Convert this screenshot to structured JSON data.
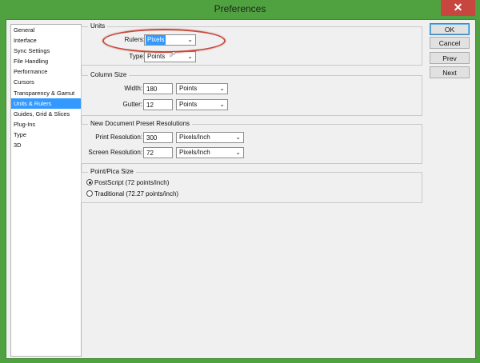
{
  "window": {
    "title": "Preferences",
    "close_glyph": "✕"
  },
  "sidebar": {
    "items": [
      {
        "label": "General"
      },
      {
        "label": "Interface"
      },
      {
        "label": "Sync Settings"
      },
      {
        "label": "File Handling"
      },
      {
        "label": "Performance"
      },
      {
        "label": "Cursors"
      },
      {
        "label": "Transparency & Gamut"
      },
      {
        "label": "Units & Rulers"
      },
      {
        "label": "Guides, Grid & Slices"
      },
      {
        "label": "Plug-Ins"
      },
      {
        "label": "Type"
      },
      {
        "label": "3D"
      }
    ],
    "selected": "Units & Rulers"
  },
  "units": {
    "legend": "Units",
    "rulers_label": "Rulers:",
    "rulers_value": "Pixels",
    "type_label": "Type:",
    "type_value": "Points"
  },
  "column_size": {
    "legend": "Column Size",
    "width_label": "Width:",
    "width_value": "180",
    "width_unit": "Points",
    "gutter_label": "Gutter:",
    "gutter_value": "12",
    "gutter_unit": "Points"
  },
  "preset_resolutions": {
    "legend": "New Document Preset Resolutions",
    "print_label": "Print Resolution:",
    "print_value": "300",
    "print_unit": "Pixels/Inch",
    "screen_label": "Screen Resolution:",
    "screen_value": "72",
    "screen_unit": "Pixels/Inch"
  },
  "point_pica": {
    "legend": "Point/Pica Size",
    "options": [
      {
        "label": "PostScript (72 points/inch)",
        "selected": true
      },
      {
        "label": "Traditional (72.27 points/inch)",
        "selected": false
      }
    ]
  },
  "buttons": {
    "ok": "OK",
    "cancel": "Cancel",
    "prev": "Prev",
    "next": "Next"
  },
  "colors": {
    "frame": "#4fa23f",
    "selection": "#3399ff",
    "annotation": "#c9473a"
  }
}
